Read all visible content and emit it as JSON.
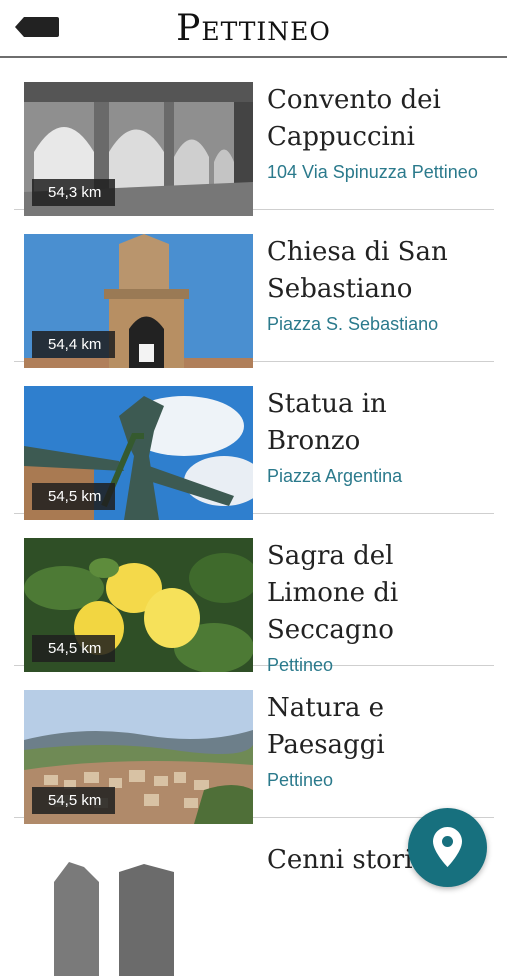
{
  "header": {
    "title": "Pettineo"
  },
  "places": [
    {
      "name": "Convento dei Cappuccini",
      "address": "104 Via Spinuzza Pettineo",
      "distance": "54,3 km"
    },
    {
      "name": "Chiesa di San Sebastiano",
      "address": "Piazza S. Sebastiano",
      "distance": "54,4 km"
    },
    {
      "name": "Statua in Bronzo",
      "address": "Piazza Argentina",
      "distance": "54,5 km"
    },
    {
      "name": "Sagra del Limone di Seccagno",
      "address": "Pettineo",
      "distance": "54,5 km"
    },
    {
      "name": "Natura e Paesaggi",
      "address": "Pettineo",
      "distance": "54,5 km"
    },
    {
      "name": "Cenni storici",
      "address": "",
      "distance": ""
    }
  ],
  "colors": {
    "accent": "#2b7a8c",
    "fab": "#17707e"
  },
  "icons": {
    "back": "back-arrow-icon",
    "map": "map-pin-icon"
  }
}
